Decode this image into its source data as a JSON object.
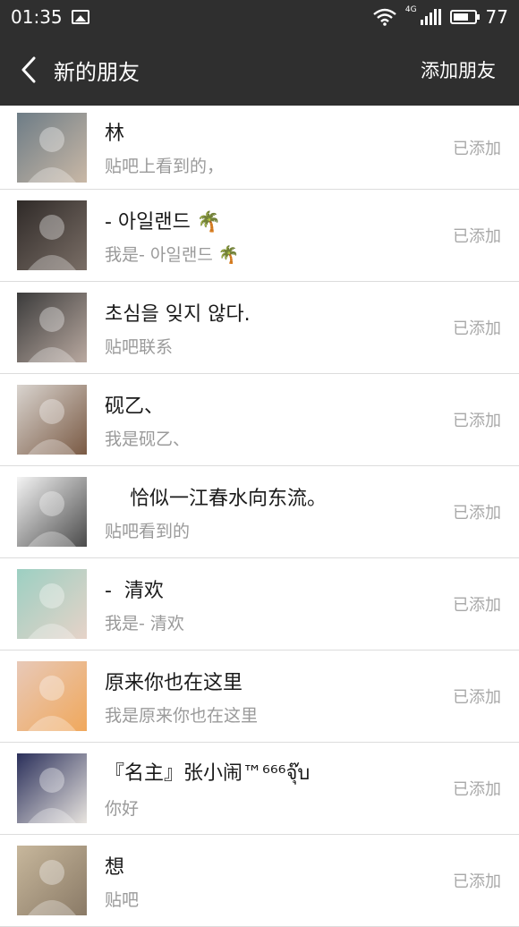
{
  "statusbar": {
    "time": "01:35",
    "network": "4G",
    "battery_text": "77",
    "battery_level": 0.77
  },
  "navbar": {
    "title": "新的朋友",
    "action": "添加朋友"
  },
  "friends": [
    {
      "name": "林",
      "message": "贴吧上看到的，",
      "status": "已添加",
      "avatar_colors": [
        "#6d7c86",
        "#c9b8a6"
      ]
    },
    {
      "name": "- 아일랜드 🌴",
      "message": "我是- 아일랜드 🌴",
      "status": "已添加",
      "avatar_colors": [
        "#2f2a28",
        "#7a6e66"
      ]
    },
    {
      "name": "초심을 잊지 않다.",
      "message": "贴吧联系",
      "status": "已添加",
      "avatar_colors": [
        "#3b3b3b",
        "#b9a9a0"
      ]
    },
    {
      "name": "砚乙、",
      "message": "我是砚乙、",
      "status": "已添加",
      "avatar_colors": [
        "#d9d4cf",
        "#7a5a44"
      ]
    },
    {
      "name": "    恰似一江春水向东流。",
      "message": "贴吧看到的",
      "status": "已添加",
      "avatar_colors": [
        "#f4f4f4",
        "#4a4a4a"
      ]
    },
    {
      "name": "-  清欢",
      "message": "我是-  清欢",
      "status": "已添加",
      "avatar_colors": [
        "#9ccfc2",
        "#e6d3c8"
      ]
    },
    {
      "name": "原来你也在这里",
      "message": "我是原来你也在这里",
      "status": "已添加",
      "avatar_colors": [
        "#e8c9b8",
        "#f0a85c"
      ]
    },
    {
      "name": "『名主』张小闹™⁶⁶⁶จุ๊บ",
      "message": "你好",
      "status": "已添加",
      "avatar_colors": [
        "#2a2f5a",
        "#e8e4df"
      ]
    },
    {
      "name": "想",
      "message": "贴吧",
      "status": "已添加",
      "avatar_colors": [
        "#c7b79c",
        "#8a7a66"
      ]
    }
  ]
}
